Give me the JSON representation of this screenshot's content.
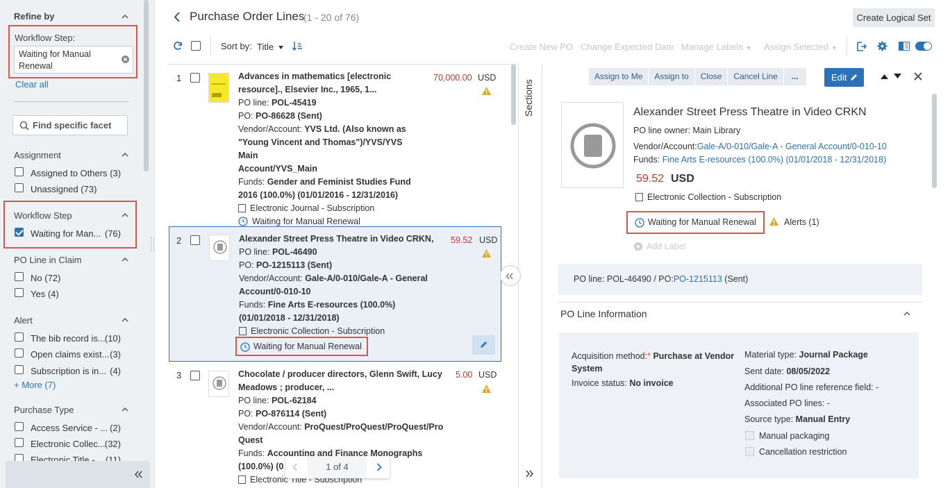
{
  "sidebar": {
    "refine_title": "Refine by",
    "workflow_label": "Workflow Step:",
    "workflow_value_l1": "Waiting for Manual",
    "workflow_value_l2": "Renewal",
    "clear_all": "Clear all",
    "find_placeholder": "Find specific facet",
    "assignment_title": "Assignment",
    "assignment_items": [
      {
        "label": "Assigned to Others",
        "count": "(3)"
      },
      {
        "label": "Unassigned",
        "count": "(73)"
      }
    ],
    "workflow_title": "Workflow Step",
    "workflow_items": [
      {
        "label": "Waiting for Man...",
        "count": "(76)"
      }
    ],
    "claim_title": "PO Line in Claim",
    "claim_items": [
      {
        "label": "No",
        "count": "(72)"
      },
      {
        "label": "Yes",
        "count": "(4)"
      }
    ],
    "alert_title": "Alert",
    "alert_items": [
      {
        "label": "The bib record is...",
        "count": "(10)"
      },
      {
        "label": "Open claims exist...",
        "count": "(3)"
      },
      {
        "label": "Subscription is in...",
        "count": "(4)"
      }
    ],
    "more_label": "+ More (7)",
    "purchase_title": "Purchase Type",
    "purchase_items": [
      {
        "label": "Access Service - ...",
        "count": "(2)"
      },
      {
        "label": "Electronic Collec...",
        "count": "(32)"
      },
      {
        "label": "Electronic Title - ...",
        "count": "(11)"
      }
    ],
    "collapse_icon": "double-chevron-left-icon"
  },
  "header": {
    "title": "Purchase Order Lines",
    "count": "(1 - 20 of 76)",
    "create_logical_set": "Create Logical Set",
    "sort_by": "Sort by:",
    "sort_value": "Title",
    "actions": [
      "Create New PO",
      "Change Expected Date",
      "Manage Labels",
      "Assign Selected"
    ]
  },
  "list": {
    "items": [
      {
        "num": "1",
        "title_l1": "Advances in mathematics [electronic",
        "title_l2": "resource]., Elsevier Inc., 1965, 1...",
        "po_line_label": "PO line:",
        "po_line": "POL-45419",
        "po_label": "PO:",
        "po": "PO-86628 (Sent)",
        "vendor_label": "Vendor/Account:",
        "vendor_l1": "YVS Ltd. (Also known as",
        "vendor_l2": "\"Young Vincent and Thomas\")/YVS/YVS Main",
        "vendor_l3": "Account/YVS_Main",
        "funds_label": "Funds:",
        "funds_l1": "Gender and Feminist Studies Fund",
        "funds_l2": "2016 (100.0%) (01/01/2016 - 12/31/2016)",
        "type": "Electronic Journal - Subscription",
        "status": "Waiting for Manual Renewal",
        "price": "70,000.00",
        "currency": "USD"
      },
      {
        "num": "2",
        "title_l1": "Alexander Street Press Theatre in Video CRKN,",
        "po_line_label": "PO line:",
        "po_line": "POL-46490",
        "po_label": "PO:",
        "po": "PO-1215113 (Sent)",
        "vendor_label": "Vendor/Account:",
        "vendor_l1": "Gale-A/0-010/Gale-A - General",
        "vendor_l2": "Account/0-010-10",
        "funds_label": "Funds:",
        "funds_l1": "Fine Arts E-resources (100.0%)",
        "funds_l2": "(01/01/2018 - 12/31/2018)",
        "type": "Electronic Collection - Subscription",
        "status": "Waiting for Manual Renewal",
        "price": "59.52",
        "currency": "USD"
      },
      {
        "num": "3",
        "title_l1": "Chocolate / producer directors, Glenn Swift, Lucy",
        "title_l2": "Meadows ; producer, ...",
        "po_line_label": "PO line:",
        "po_line": "POL-62184",
        "po_label": "PO:",
        "po": "PO-876114 (Sent)",
        "vendor_label": "Vendor/Account:",
        "vendor_l1": "ProQuest/ProQuest/ProQuest/Pro",
        "vendor_l2": "Quest",
        "funds_label": "Funds:",
        "funds_l1": "Accounting and Finance Monographs",
        "funds_l2": "(100.0%) (0",
        "type": "Electronic Title - Subscription",
        "price": "5.00",
        "currency": "USD"
      }
    ],
    "pager": "1 of 4"
  },
  "sections_label": "Sections",
  "detail": {
    "buttons": [
      "Assign to Me",
      "Assign to",
      "Close",
      "Cancel Line",
      "..."
    ],
    "edit": "Edit",
    "title": "Alexander Street Press Theatre in Video CRKN",
    "owner_label": "PO line owner:",
    "owner": "Main Library",
    "vendor_label": "Vendor/Account:",
    "vendor": "Gale-A/0-010/Gale-A - General Account/0-010-10",
    "funds_label": "Funds:",
    "funds": "Fine Arts E-resources (100.0%) (01/01/2018 - 12/31/2018)",
    "price": "59.52",
    "currency": "USD",
    "type": "Electronic Collection - Subscription",
    "status": "Waiting for Manual Renewal",
    "alerts": "Alerts (1)",
    "add_label": "Add Label",
    "summary_prefix": "PO line: POL-46490 / PO:",
    "summary_po": "PO-1215113",
    "summary_suffix": "(Sent)",
    "section_title": "PO Line Information",
    "acq_label": "Acquisition method:",
    "acq_value_l1": "Purchase at Vendor",
    "acq_value_l2": "System",
    "invoice_label": "Invoice status:",
    "invoice_value": "No invoice",
    "material_label": "Material type:",
    "material_value": "Journal Package",
    "sent_label": "Sent date:",
    "sent_value": "08/05/2022",
    "addref_label": "Additional PO line reference field:",
    "addref_value": "-",
    "assoc_label": "Associated PO lines:",
    "assoc_value": "-",
    "source_label": "Source type:",
    "source_value": "Manual Entry",
    "manual_packaging": "Manual packaging",
    "cancel_restriction": "Cancellation restriction"
  }
}
